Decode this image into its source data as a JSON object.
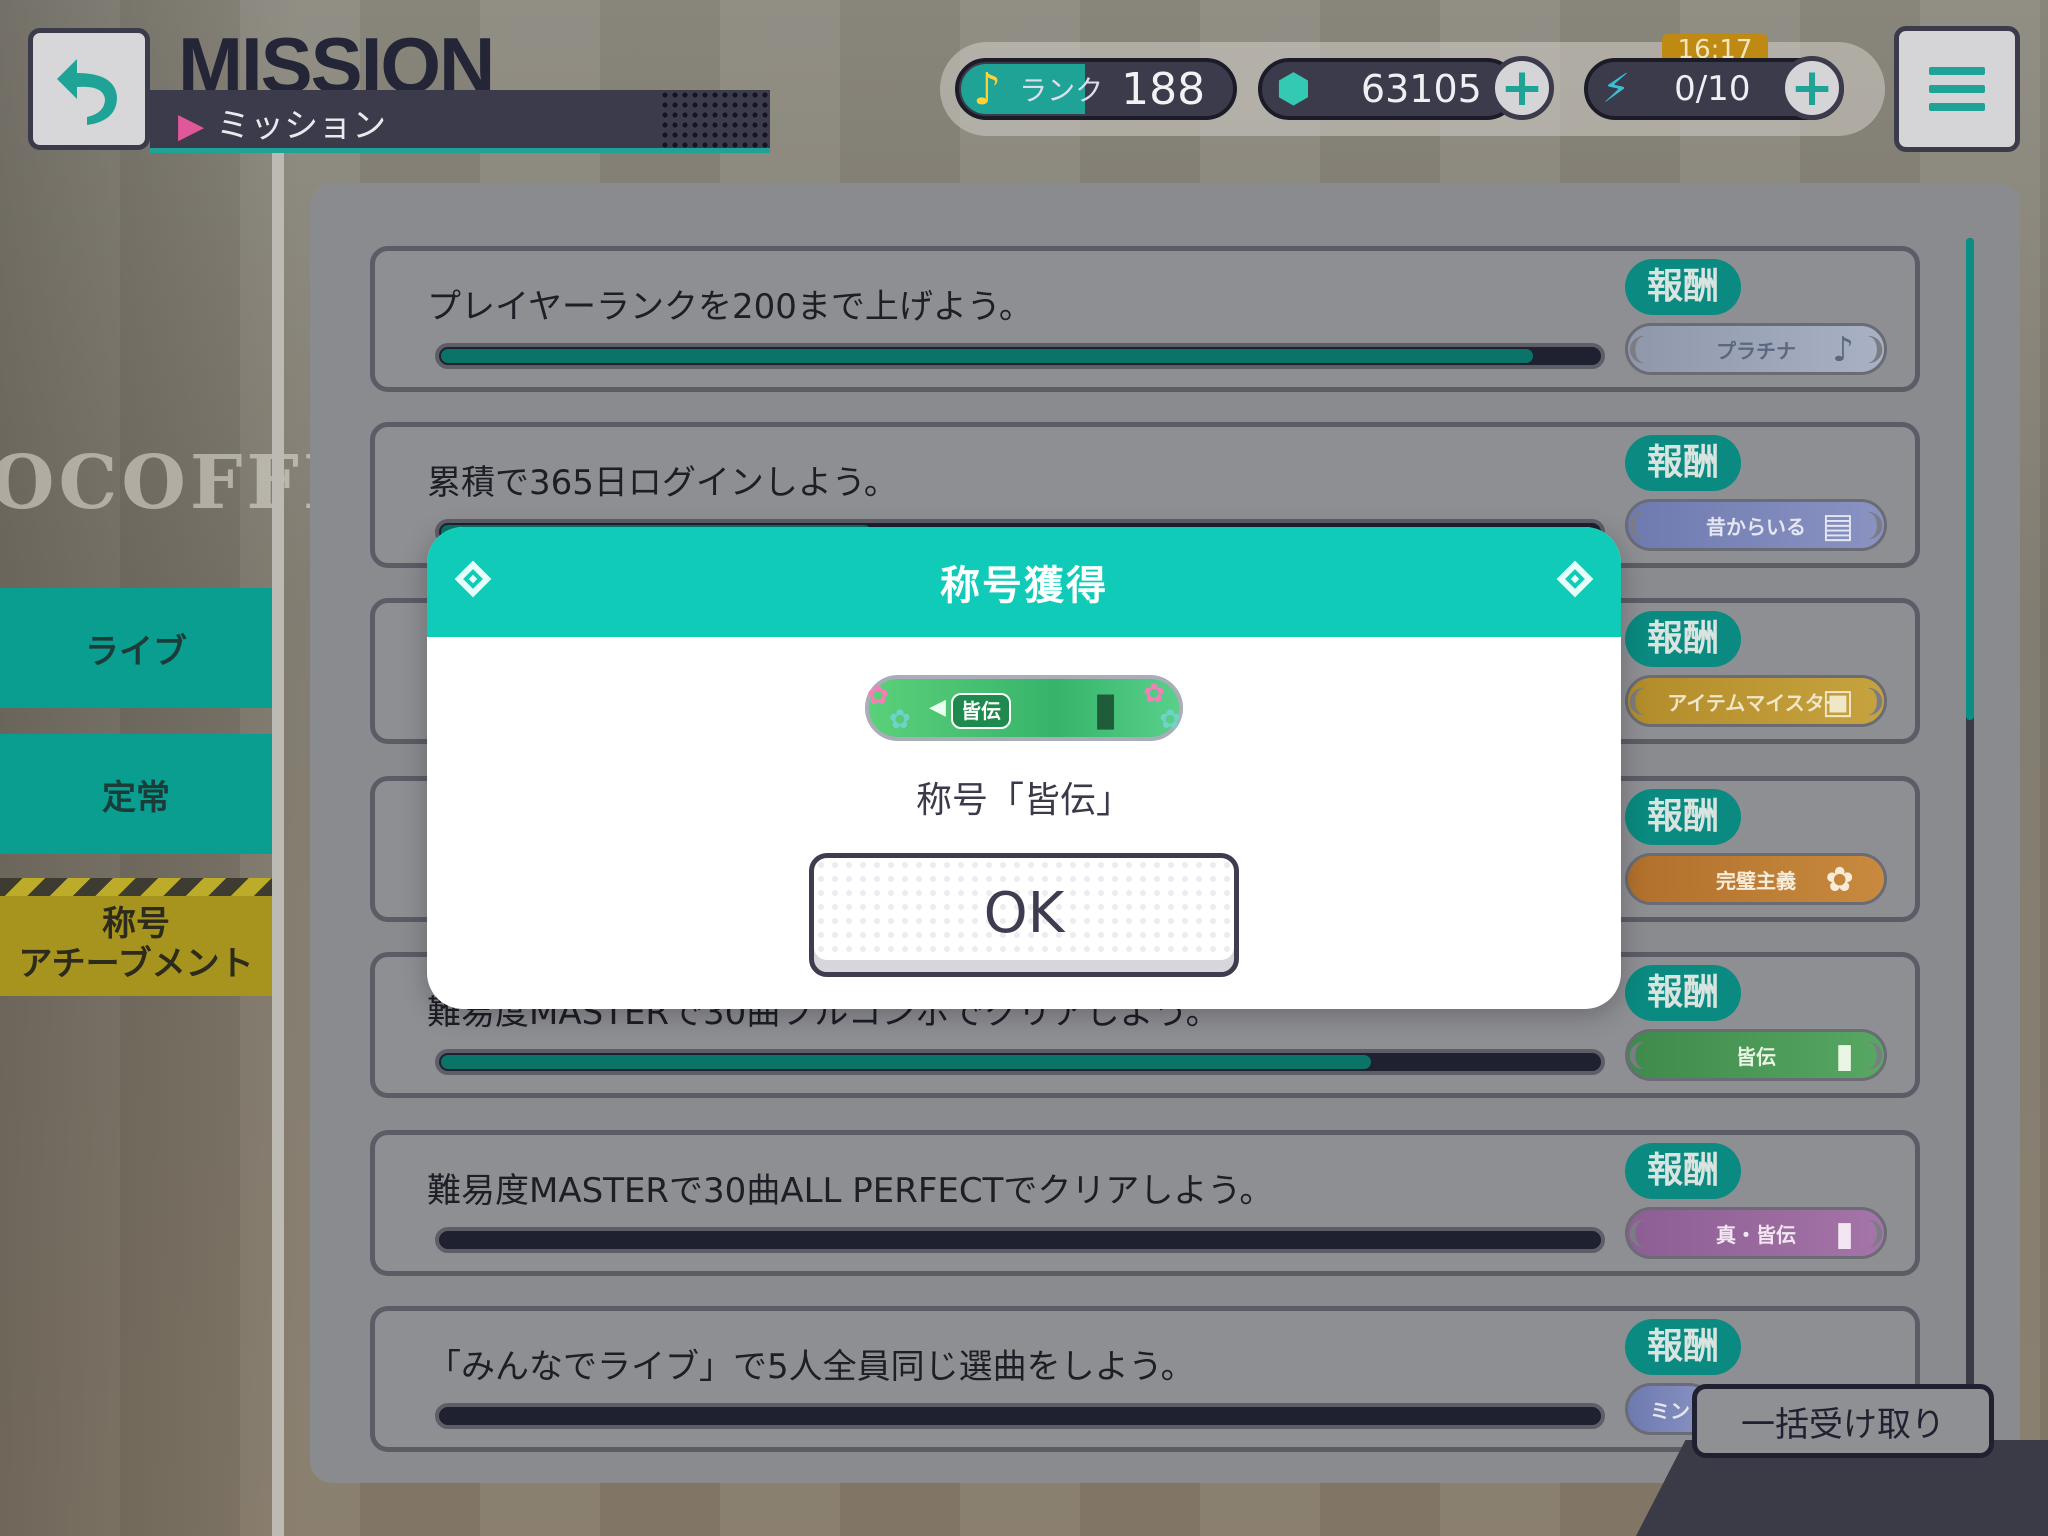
{
  "header": {
    "title": "MISSION",
    "subtitle": "ミッション",
    "rank_label": "ランク",
    "rank_value": "188",
    "gems": "63105",
    "energy": "0/10",
    "timer": "16:17"
  },
  "background": {
    "sign_text": "OCOFFEE"
  },
  "sidebar": {
    "items": [
      {
        "label": "ライブ"
      },
      {
        "label": "定常"
      },
      {
        "label_line1": "称号",
        "label_line2": "アチーブメント"
      }
    ]
  },
  "missions": [
    {
      "text": "プレイヤーランクを200まで上げよう。",
      "progress": 0.94,
      "reward_label": "報酬",
      "reward_title": "プラチナ",
      "reward_color": "#8f98ab"
    },
    {
      "text": "累積で365日ログインしよう。",
      "progress": 0.37,
      "reward_label": "報酬",
      "reward_title": "昔からいる",
      "reward_color": "#6e7ab0"
    },
    {
      "text": "",
      "progress": 0.0,
      "reward_label": "報酬",
      "reward_title": "アイテムマイスター",
      "reward_color": "#b28c2a"
    },
    {
      "text": "",
      "progress": 0.0,
      "reward_label": "報酬",
      "reward_title": "完璧主義",
      "reward_color": "#b1702c"
    },
    {
      "text": "難易度MASTERで30曲フルコンボでクリアしよう。",
      "progress": 0.8,
      "reward_label": "報酬",
      "reward_title": "皆伝",
      "reward_color": "#3f8a4c"
    },
    {
      "text": "難易度MASTERで30曲ALL PERFECTでクリアしよう。",
      "progress": 0.0,
      "reward_label": "報酬",
      "reward_title": "真・皆伝",
      "reward_color": "#8c5e93"
    },
    {
      "text": "「みんなでライブ」で5人全員同じ選曲をしよう。",
      "progress": 0.0,
      "reward_label": "報酬",
      "reward_title": "ミン",
      "reward_color": "#6e7ab0"
    }
  ],
  "bulk_receive_label": "一括受け取り",
  "dialog": {
    "title": "称号獲得",
    "plate_text": "皆伝",
    "award_name": "称号「皆伝」",
    "ok_label": "OK"
  }
}
